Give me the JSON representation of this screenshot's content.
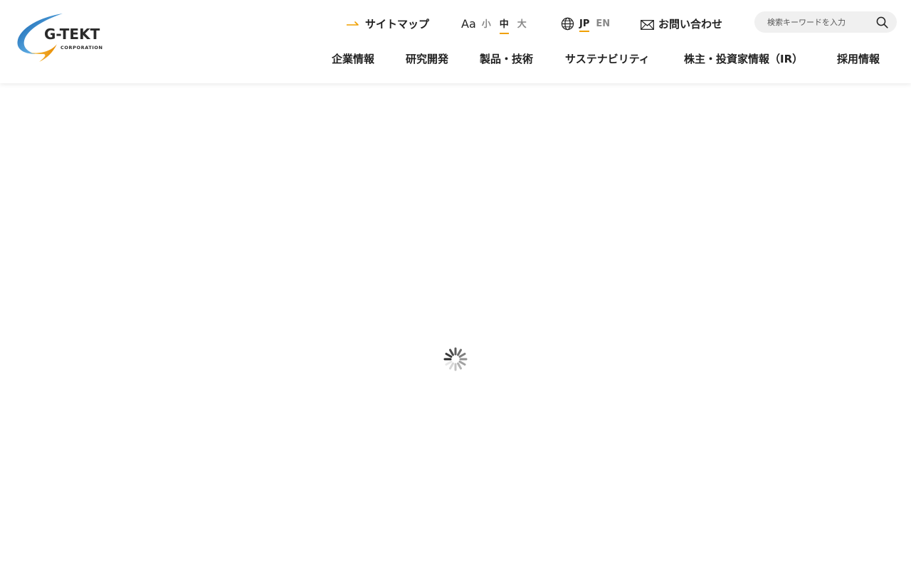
{
  "header": {
    "logo": {
      "name": "G-TEKT",
      "subtitle": "CORPORATION",
      "colors": {
        "blue": "#1e6fb8",
        "light_blue": "#7ab8e6",
        "orange": "#f0a000"
      }
    },
    "utility": {
      "sitemap_label": "サイトマップ",
      "font_size": {
        "icon_label": "Aa",
        "options": [
          "小",
          "中",
          "大"
        ],
        "selected": "中"
      },
      "language": {
        "options": [
          "JP",
          "EN"
        ],
        "selected": "JP"
      },
      "contact_label": "お問い合わせ",
      "search": {
        "placeholder": "検索キーワードを入力",
        "value": ""
      }
    },
    "nav": [
      {
        "label": "企業情報"
      },
      {
        "label": "研究開発"
      },
      {
        "label": "製品・技術"
      },
      {
        "label": "サステナビリティ"
      },
      {
        "label": "株主・投資家情報（IR）"
      },
      {
        "label": "採用情報"
      }
    ],
    "accent_color": "#f0a000"
  },
  "main": {
    "loading": true,
    "loading_icon": "spinner-icon"
  }
}
